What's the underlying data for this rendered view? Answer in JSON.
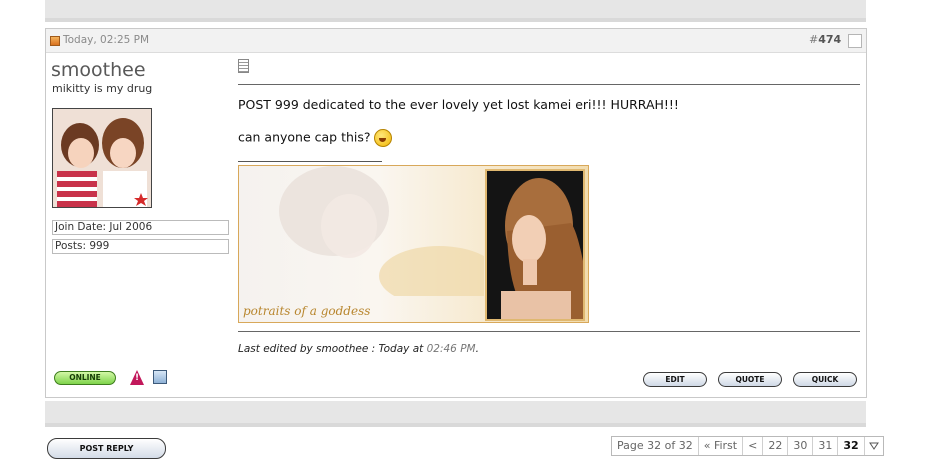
{
  "post": {
    "date": "Today, 02:25 PM",
    "number_prefix": "#",
    "number": "474",
    "author": {
      "username": "smoothee",
      "user_title": "mikitty is my drug",
      "join_date": "Join Date: Jul 2006",
      "posts": "Posts: 999",
      "status": "ONLINE"
    },
    "message": {
      "line1": "POST 999 dedicated to the ever lovely yet lost kamei eri!!! HURRAH!!!",
      "line2": "can anyone cap this?"
    },
    "signature": {
      "caption": "potraits of a goddess"
    },
    "edited": {
      "prefix": "Last edited by smoothee : Today at ",
      "time": "02:46 PM",
      "suffix": "."
    },
    "buttons": {
      "edit": "EDIT",
      "quote": "QUOTE",
      "quick": "QUICK"
    }
  },
  "post_reply": "POST REPLY",
  "pagination": {
    "label": "Page 32 of 32",
    "first": "« First",
    "prev": "<",
    "pages": [
      "22",
      "30",
      "31",
      "32"
    ],
    "current": "32"
  },
  "icons": [
    "post-icon",
    "content-icon",
    "smiley-icon",
    "warning-icon",
    "computer-icon",
    "dropdown-triangle-icon"
  ],
  "colors": {
    "online": "#7ed34b",
    "signature_border": "#d8a85a",
    "warning": "#c2185b"
  }
}
